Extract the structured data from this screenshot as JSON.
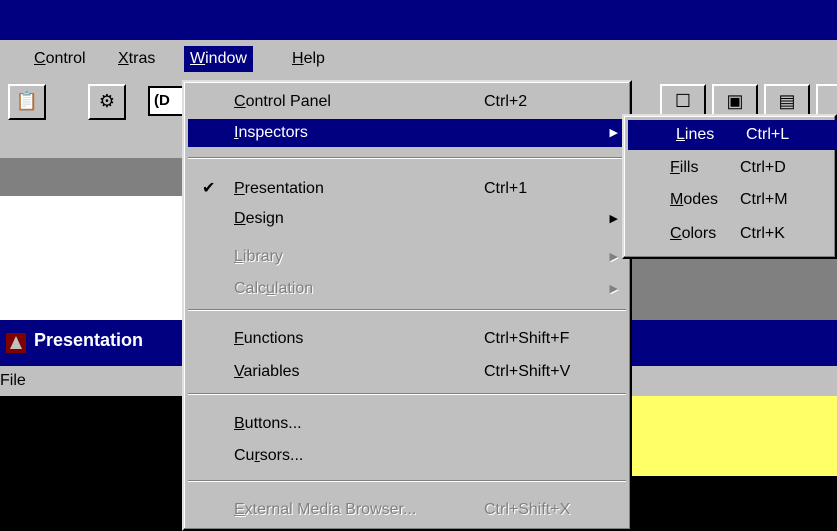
{
  "menubar": {
    "items": [
      {
        "label": "Control",
        "u": "C",
        "rest": "ontrol"
      },
      {
        "label": "Xtras",
        "u": "X",
        "rest": "tras"
      },
      {
        "label": "Window",
        "u": "W",
        "rest": "indow"
      },
      {
        "label": "Help",
        "u": "H",
        "rest": "elp"
      }
    ]
  },
  "toolbar": {
    "field_text": "(D",
    "icons": [
      "paste-icon",
      "tools-icon",
      "toolbar-icon-a",
      "toolbar-icon-b",
      "toolbar-icon-c"
    ]
  },
  "presentation_window": {
    "title": "Presentation",
    "menu_file": "File"
  },
  "window_menu": {
    "items": [
      {
        "id": "control-panel",
        "pre": "",
        "u": "C",
        "post": "ontrol Panel",
        "shortcut": "Ctrl+2",
        "state": "normal"
      },
      {
        "id": "inspectors",
        "pre": "",
        "u": "I",
        "post": "nspectors",
        "shortcut": "",
        "state": "highlighted",
        "submenu": true
      },
      {
        "id": "presentation",
        "pre": "",
        "u": "P",
        "post": "resentation",
        "shortcut": "Ctrl+1",
        "state": "checked"
      },
      {
        "id": "design",
        "pre": "",
        "u": "D",
        "post": "esign",
        "shortcut": "",
        "state": "normal",
        "submenu": true
      },
      {
        "id": "library",
        "pre": "",
        "u": "L",
        "post": "ibrary",
        "shortcut": "",
        "state": "disabled",
        "submenu": true
      },
      {
        "id": "calculation",
        "pre": "Calc",
        "u": "u",
        "post": "lation",
        "shortcut": "",
        "state": "disabled",
        "submenu": true
      },
      {
        "id": "functions",
        "pre": "",
        "u": "F",
        "post": "unctions",
        "shortcut": "Ctrl+Shift+F",
        "state": "normal"
      },
      {
        "id": "variables",
        "pre": "",
        "u": "V",
        "post": "ariables",
        "shortcut": "Ctrl+Shift+V",
        "state": "normal"
      },
      {
        "id": "buttons",
        "pre": "",
        "u": "B",
        "post": "uttons...",
        "shortcut": "",
        "state": "normal"
      },
      {
        "id": "cursors",
        "pre": "Cu",
        "u": "r",
        "post": "sors...",
        "shortcut": "",
        "state": "normal"
      },
      {
        "id": "external-media-browser",
        "pre": "",
        "u": "E",
        "post": "xternal Media Browser...",
        "shortcut": "Ctrl+Shift+X",
        "state": "disabled"
      }
    ]
  },
  "inspectors_submenu": {
    "items": [
      {
        "id": "lines",
        "u": "L",
        "post": "ines",
        "shortcut": "Ctrl+L",
        "state": "highlighted"
      },
      {
        "id": "fills",
        "u": "F",
        "post": "ills",
        "shortcut": "Ctrl+D",
        "state": "normal"
      },
      {
        "id": "modes",
        "u": "M",
        "post": "odes",
        "shortcut": "Ctrl+M",
        "state": "normal"
      },
      {
        "id": "colors",
        "u": "C",
        "post": "olors",
        "shortcut": "Ctrl+K",
        "state": "normal"
      }
    ]
  },
  "colors": {
    "menu_highlight": "#000080",
    "window_face": "#c0c0c0",
    "yellow_panel": "#ffff66"
  }
}
